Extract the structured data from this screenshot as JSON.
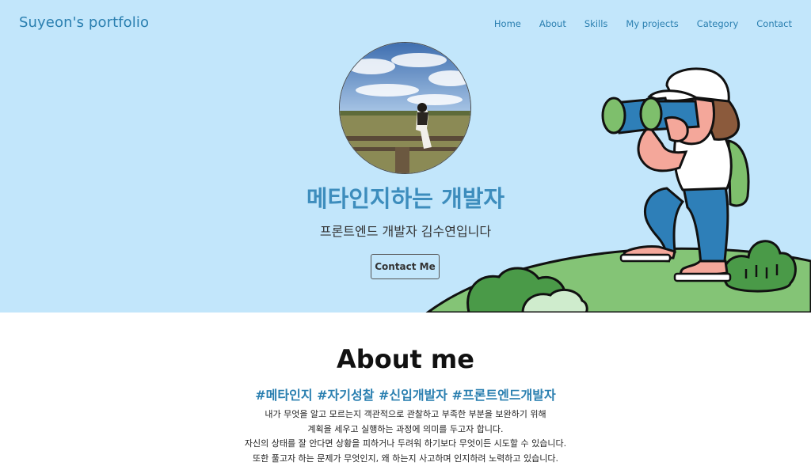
{
  "header": {
    "brand": "Suyeon's portfolio",
    "nav": [
      "Home",
      "About",
      "Skills",
      "My projects",
      "Category",
      "Contact"
    ]
  },
  "hero": {
    "title": "메타인지하는 개발자",
    "subtitle": "프론트엔드 개발자 김수연입니다",
    "contact_button": "Contact Me"
  },
  "about": {
    "title": "About me",
    "tags": "#메타인지 #자기성찰 #신입개발자 #프론트엔드개발자",
    "lines": [
      "내가 무엇을 알고 모르는지 객관적으로 관찰하고 부족한 부분을 보완하기 위해",
      "계획을 세우고 실행하는 과정에 의미를 두고자 합니다.",
      "자신의 상태를 잘 안다면 상황을 피하거나 두려워 하기보다 무엇이든 시도할 수 있습니다.",
      "또한 풀고자 하는 문제가 무엇인지, 왜 하는지 사고하며 인지하려 노력하고 있습니다."
    ]
  },
  "colors": {
    "hero_background": "#c2e6fb",
    "accent": "#2a7fb0",
    "hill": "#84c476"
  }
}
